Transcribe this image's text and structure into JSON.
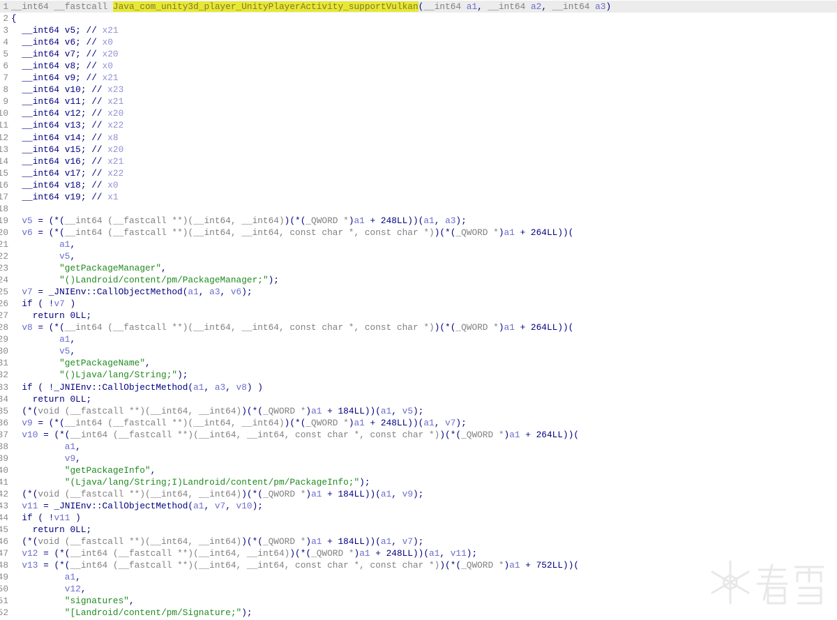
{
  "view": "pseudocode",
  "current_line": 1,
  "watermark": {
    "text": "看雪"
  },
  "lines": [
    {
      "n": "1",
      "seg": [
        [
          "k",
          "__int64 __fastcall "
        ],
        [
          "h",
          "Java_com_unity3d_player_UnityPlayerActivit"
        ],
        [
          "cursor",
          ""
        ],
        [
          "h",
          "y_supportVulkan"
        ],
        [
          "n",
          "("
        ],
        [
          "k",
          "__int64 "
        ],
        [
          "v",
          "a1"
        ],
        [
          "n",
          ", "
        ],
        [
          "k",
          "__int64 "
        ],
        [
          "v",
          "a2"
        ],
        [
          "n",
          ", "
        ],
        [
          "k",
          "__int64 "
        ],
        [
          "v",
          "a3"
        ],
        [
          "n",
          ")"
        ]
      ]
    },
    {
      "n": "2",
      "seg": [
        [
          "n",
          "{"
        ]
      ]
    },
    {
      "n": "3",
      "seg": [
        [
          "n",
          "  __int64 v5; // "
        ],
        [
          "c",
          "x21"
        ]
      ]
    },
    {
      "n": "4",
      "seg": [
        [
          "n",
          "  __int64 v6; // "
        ],
        [
          "c",
          "x0"
        ]
      ]
    },
    {
      "n": "5",
      "seg": [
        [
          "n",
          "  __int64 v7; // "
        ],
        [
          "c",
          "x20"
        ]
      ]
    },
    {
      "n": "6",
      "seg": [
        [
          "n",
          "  __int64 v8; // "
        ],
        [
          "c",
          "x0"
        ]
      ]
    },
    {
      "n": "7",
      "seg": [
        [
          "n",
          "  __int64 v9; // "
        ],
        [
          "c",
          "x21"
        ]
      ]
    },
    {
      "n": "8",
      "seg": [
        [
          "n",
          "  __int64 v10; // "
        ],
        [
          "c",
          "x23"
        ]
      ]
    },
    {
      "n": "9",
      "seg": [
        [
          "n",
          "  __int64 v11; // "
        ],
        [
          "c",
          "x21"
        ]
      ]
    },
    {
      "n": "10",
      "seg": [
        [
          "n",
          "  __int64 v12; // "
        ],
        [
          "c",
          "x20"
        ]
      ]
    },
    {
      "n": "11",
      "seg": [
        [
          "n",
          "  __int64 v13; // "
        ],
        [
          "c",
          "x22"
        ]
      ]
    },
    {
      "n": "12",
      "seg": [
        [
          "n",
          "  __int64 v14; // "
        ],
        [
          "c",
          "x8"
        ]
      ]
    },
    {
      "n": "13",
      "seg": [
        [
          "n",
          "  __int64 v15; // "
        ],
        [
          "c",
          "x20"
        ]
      ]
    },
    {
      "n": "14",
      "seg": [
        [
          "n",
          "  __int64 v16; // "
        ],
        [
          "c",
          "x21"
        ]
      ]
    },
    {
      "n": "15",
      "seg": [
        [
          "n",
          "  __int64 v17; // "
        ],
        [
          "c",
          "x22"
        ]
      ]
    },
    {
      "n": "16",
      "seg": [
        [
          "n",
          "  __int64 v18; // "
        ],
        [
          "c",
          "x0"
        ]
      ]
    },
    {
      "n": "17",
      "seg": [
        [
          "n",
          "  __int64 v19; // "
        ],
        [
          "c",
          "x1"
        ]
      ]
    },
    {
      "n": "18",
      "seg": []
    },
    {
      "n": "19",
      "seg": [
        [
          "n",
          "  "
        ],
        [
          "v",
          "v5"
        ],
        [
          "n",
          " = (*("
        ],
        [
          "k",
          "__int64 (__fastcall **)(__int64, __int64)"
        ],
        [
          "n",
          ")(*("
        ],
        [
          "k",
          "_QWORD *"
        ],
        [
          "n",
          ")"
        ],
        [
          "v",
          "a1"
        ],
        [
          "n",
          " + 248LL))("
        ],
        [
          "v",
          "a1"
        ],
        [
          "n",
          ", "
        ],
        [
          "v",
          "a3"
        ],
        [
          "n",
          ");"
        ]
      ]
    },
    {
      "n": "20",
      "seg": [
        [
          "n",
          "  "
        ],
        [
          "v",
          "v6"
        ],
        [
          "n",
          " = (*("
        ],
        [
          "k",
          "__int64 (__fastcall **)(__int64, __int64, const char *, const char *)"
        ],
        [
          "n",
          ")(*("
        ],
        [
          "k",
          "_QWORD *"
        ],
        [
          "n",
          ")"
        ],
        [
          "v",
          "a1"
        ],
        [
          "n",
          " + 264LL))("
        ]
      ]
    },
    {
      "n": "21",
      "seg": [
        [
          "n",
          "         "
        ],
        [
          "v",
          "a1"
        ],
        [
          "n",
          ","
        ]
      ]
    },
    {
      "n": "22",
      "seg": [
        [
          "n",
          "         "
        ],
        [
          "v",
          "v5"
        ],
        [
          "n",
          ","
        ]
      ]
    },
    {
      "n": "23",
      "seg": [
        [
          "n",
          "         "
        ],
        [
          "s",
          "\"getPackageManager\""
        ],
        [
          "n",
          ","
        ]
      ]
    },
    {
      "n": "24",
      "seg": [
        [
          "n",
          "         "
        ],
        [
          "s",
          "\"()Landroid/content/pm/PackageManager;\""
        ],
        [
          "n",
          ");"
        ]
      ]
    },
    {
      "n": "25",
      "seg": [
        [
          "n",
          "  "
        ],
        [
          "v",
          "v7"
        ],
        [
          "n",
          " = _JNIEnv::CallObjectMethod("
        ],
        [
          "v",
          "a1"
        ],
        [
          "n",
          ", "
        ],
        [
          "v",
          "a3"
        ],
        [
          "n",
          ", "
        ],
        [
          "v",
          "v6"
        ],
        [
          "n",
          ");"
        ]
      ]
    },
    {
      "n": "26",
      "seg": [
        [
          "n",
          "  if ( !"
        ],
        [
          "v",
          "v7"
        ],
        [
          "n",
          " )"
        ]
      ]
    },
    {
      "n": "27",
      "seg": [
        [
          "n",
          "    return 0LL;"
        ]
      ]
    },
    {
      "n": "28",
      "seg": [
        [
          "n",
          "  "
        ],
        [
          "v",
          "v8"
        ],
        [
          "n",
          " = (*("
        ],
        [
          "k",
          "__int64 (__fastcall **)(__int64, __int64, const char *, const char *)"
        ],
        [
          "n",
          ")(*("
        ],
        [
          "k",
          "_QWORD *"
        ],
        [
          "n",
          ")"
        ],
        [
          "v",
          "a1"
        ],
        [
          "n",
          " + 264LL))("
        ]
      ]
    },
    {
      "n": "29",
      "seg": [
        [
          "n",
          "         "
        ],
        [
          "v",
          "a1"
        ],
        [
          "n",
          ","
        ]
      ]
    },
    {
      "n": "30",
      "seg": [
        [
          "n",
          "         "
        ],
        [
          "v",
          "v5"
        ],
        [
          "n",
          ","
        ]
      ]
    },
    {
      "n": "31",
      "seg": [
        [
          "n",
          "         "
        ],
        [
          "s",
          "\"getPackageName\""
        ],
        [
          "n",
          ","
        ]
      ]
    },
    {
      "n": "32",
      "seg": [
        [
          "n",
          "         "
        ],
        [
          "s",
          "\"()Ljava/lang/String;\""
        ],
        [
          "n",
          ");"
        ]
      ]
    },
    {
      "n": "33",
      "seg": [
        [
          "n",
          "  if ( !_JNIEnv::CallObjectMethod("
        ],
        [
          "v",
          "a1"
        ],
        [
          "n",
          ", "
        ],
        [
          "v",
          "a3"
        ],
        [
          "n",
          ", "
        ],
        [
          "v",
          "v8"
        ],
        [
          "n",
          ") )"
        ]
      ]
    },
    {
      "n": "34",
      "seg": [
        [
          "n",
          "    return 0LL;"
        ]
      ]
    },
    {
      "n": "35",
      "seg": [
        [
          "n",
          "  (*("
        ],
        [
          "k",
          "void (__fastcall **)(__int64, __int64)"
        ],
        [
          "n",
          ")(*("
        ],
        [
          "k",
          "_QWORD *"
        ],
        [
          "n",
          ")"
        ],
        [
          "v",
          "a1"
        ],
        [
          "n",
          " + 184LL))("
        ],
        [
          "v",
          "a1"
        ],
        [
          "n",
          ", "
        ],
        [
          "v",
          "v5"
        ],
        [
          "n",
          ");"
        ]
      ]
    },
    {
      "n": "36",
      "seg": [
        [
          "n",
          "  "
        ],
        [
          "v",
          "v9"
        ],
        [
          "n",
          " = (*("
        ],
        [
          "k",
          "__int64 (__fastcall **)(__int64, __int64)"
        ],
        [
          "n",
          ")(*("
        ],
        [
          "k",
          "_QWORD *"
        ],
        [
          "n",
          ")"
        ],
        [
          "v",
          "a1"
        ],
        [
          "n",
          " + 248LL))("
        ],
        [
          "v",
          "a1"
        ],
        [
          "n",
          ", "
        ],
        [
          "v",
          "v7"
        ],
        [
          "n",
          ");"
        ]
      ]
    },
    {
      "n": "37",
      "seg": [
        [
          "n",
          "  "
        ],
        [
          "v",
          "v10"
        ],
        [
          "n",
          " = (*("
        ],
        [
          "k",
          "__int64 (__fastcall **)(__int64, __int64, const char *, const char *)"
        ],
        [
          "n",
          ")(*("
        ],
        [
          "k",
          "_QWORD *"
        ],
        [
          "n",
          ")"
        ],
        [
          "v",
          "a1"
        ],
        [
          "n",
          " + 264LL))("
        ]
      ]
    },
    {
      "n": "38",
      "seg": [
        [
          "n",
          "          "
        ],
        [
          "v",
          "a1"
        ],
        [
          "n",
          ","
        ]
      ]
    },
    {
      "n": "39",
      "seg": [
        [
          "n",
          "          "
        ],
        [
          "v",
          "v9"
        ],
        [
          "n",
          ","
        ]
      ]
    },
    {
      "n": "40",
      "seg": [
        [
          "n",
          "          "
        ],
        [
          "s",
          "\"getPackageInfo\""
        ],
        [
          "n",
          ","
        ]
      ]
    },
    {
      "n": "41",
      "seg": [
        [
          "n",
          "          "
        ],
        [
          "s",
          "\"(Ljava/lang/String;I)Landroid/content/pm/PackageInfo;\""
        ],
        [
          "n",
          ");"
        ]
      ]
    },
    {
      "n": "42",
      "seg": [
        [
          "n",
          "  (*("
        ],
        [
          "k",
          "void (__fastcall **)(__int64, __int64)"
        ],
        [
          "n",
          ")(*("
        ],
        [
          "k",
          "_QWORD *"
        ],
        [
          "n",
          ")"
        ],
        [
          "v",
          "a1"
        ],
        [
          "n",
          " + 184LL))("
        ],
        [
          "v",
          "a1"
        ],
        [
          "n",
          ", "
        ],
        [
          "v",
          "v9"
        ],
        [
          "n",
          ");"
        ]
      ]
    },
    {
      "n": "43",
      "seg": [
        [
          "n",
          "  "
        ],
        [
          "v",
          "v11"
        ],
        [
          "n",
          " = _JNIEnv::CallObjectMethod("
        ],
        [
          "v",
          "a1"
        ],
        [
          "n",
          ", "
        ],
        [
          "v",
          "v7"
        ],
        [
          "n",
          ", "
        ],
        [
          "v",
          "v10"
        ],
        [
          "n",
          ");"
        ]
      ]
    },
    {
      "n": "44",
      "seg": [
        [
          "n",
          "  if ( !"
        ],
        [
          "v",
          "v11"
        ],
        [
          "n",
          " )"
        ]
      ]
    },
    {
      "n": "45",
      "seg": [
        [
          "n",
          "    return 0LL;"
        ]
      ]
    },
    {
      "n": "46",
      "seg": [
        [
          "n",
          "  (*("
        ],
        [
          "k",
          "void (__fastcall **)(__int64, __int64)"
        ],
        [
          "n",
          ")(*("
        ],
        [
          "k",
          "_QWORD *"
        ],
        [
          "n",
          ")"
        ],
        [
          "v",
          "a1"
        ],
        [
          "n",
          " + 184LL))("
        ],
        [
          "v",
          "a1"
        ],
        [
          "n",
          ", "
        ],
        [
          "v",
          "v7"
        ],
        [
          "n",
          ");"
        ]
      ]
    },
    {
      "n": "47",
      "seg": [
        [
          "n",
          "  "
        ],
        [
          "v",
          "v12"
        ],
        [
          "n",
          " = (*("
        ],
        [
          "k",
          "__int64 (__fastcall **)(__int64, __int64)"
        ],
        [
          "n",
          ")(*("
        ],
        [
          "k",
          "_QWORD *"
        ],
        [
          "n",
          ")"
        ],
        [
          "v",
          "a1"
        ],
        [
          "n",
          " + 248LL))("
        ],
        [
          "v",
          "a1"
        ],
        [
          "n",
          ", "
        ],
        [
          "v",
          "v11"
        ],
        [
          "n",
          ");"
        ]
      ]
    },
    {
      "n": "48",
      "seg": [
        [
          "n",
          "  "
        ],
        [
          "v",
          "v13"
        ],
        [
          "n",
          " = (*("
        ],
        [
          "k",
          "__int64 (__fastcall **)(__int64, __int64, const char *, const char *)"
        ],
        [
          "n",
          ")(*("
        ],
        [
          "k",
          "_QWORD *"
        ],
        [
          "n",
          ")"
        ],
        [
          "v",
          "a1"
        ],
        [
          "n",
          " + 752LL))("
        ]
      ]
    },
    {
      "n": "49",
      "seg": [
        [
          "n",
          "          "
        ],
        [
          "v",
          "a1"
        ],
        [
          "n",
          ","
        ]
      ]
    },
    {
      "n": "50",
      "seg": [
        [
          "n",
          "          "
        ],
        [
          "v",
          "v12"
        ],
        [
          "n",
          ","
        ]
      ]
    },
    {
      "n": "51",
      "seg": [
        [
          "n",
          "          "
        ],
        [
          "s",
          "\"signatures\""
        ],
        [
          "n",
          ","
        ]
      ]
    },
    {
      "n": "52",
      "seg": [
        [
          "n",
          "          "
        ],
        [
          "s",
          "\"[Landroid/content/pm/Signature;\""
        ],
        [
          "n",
          ");"
        ]
      ]
    }
  ]
}
